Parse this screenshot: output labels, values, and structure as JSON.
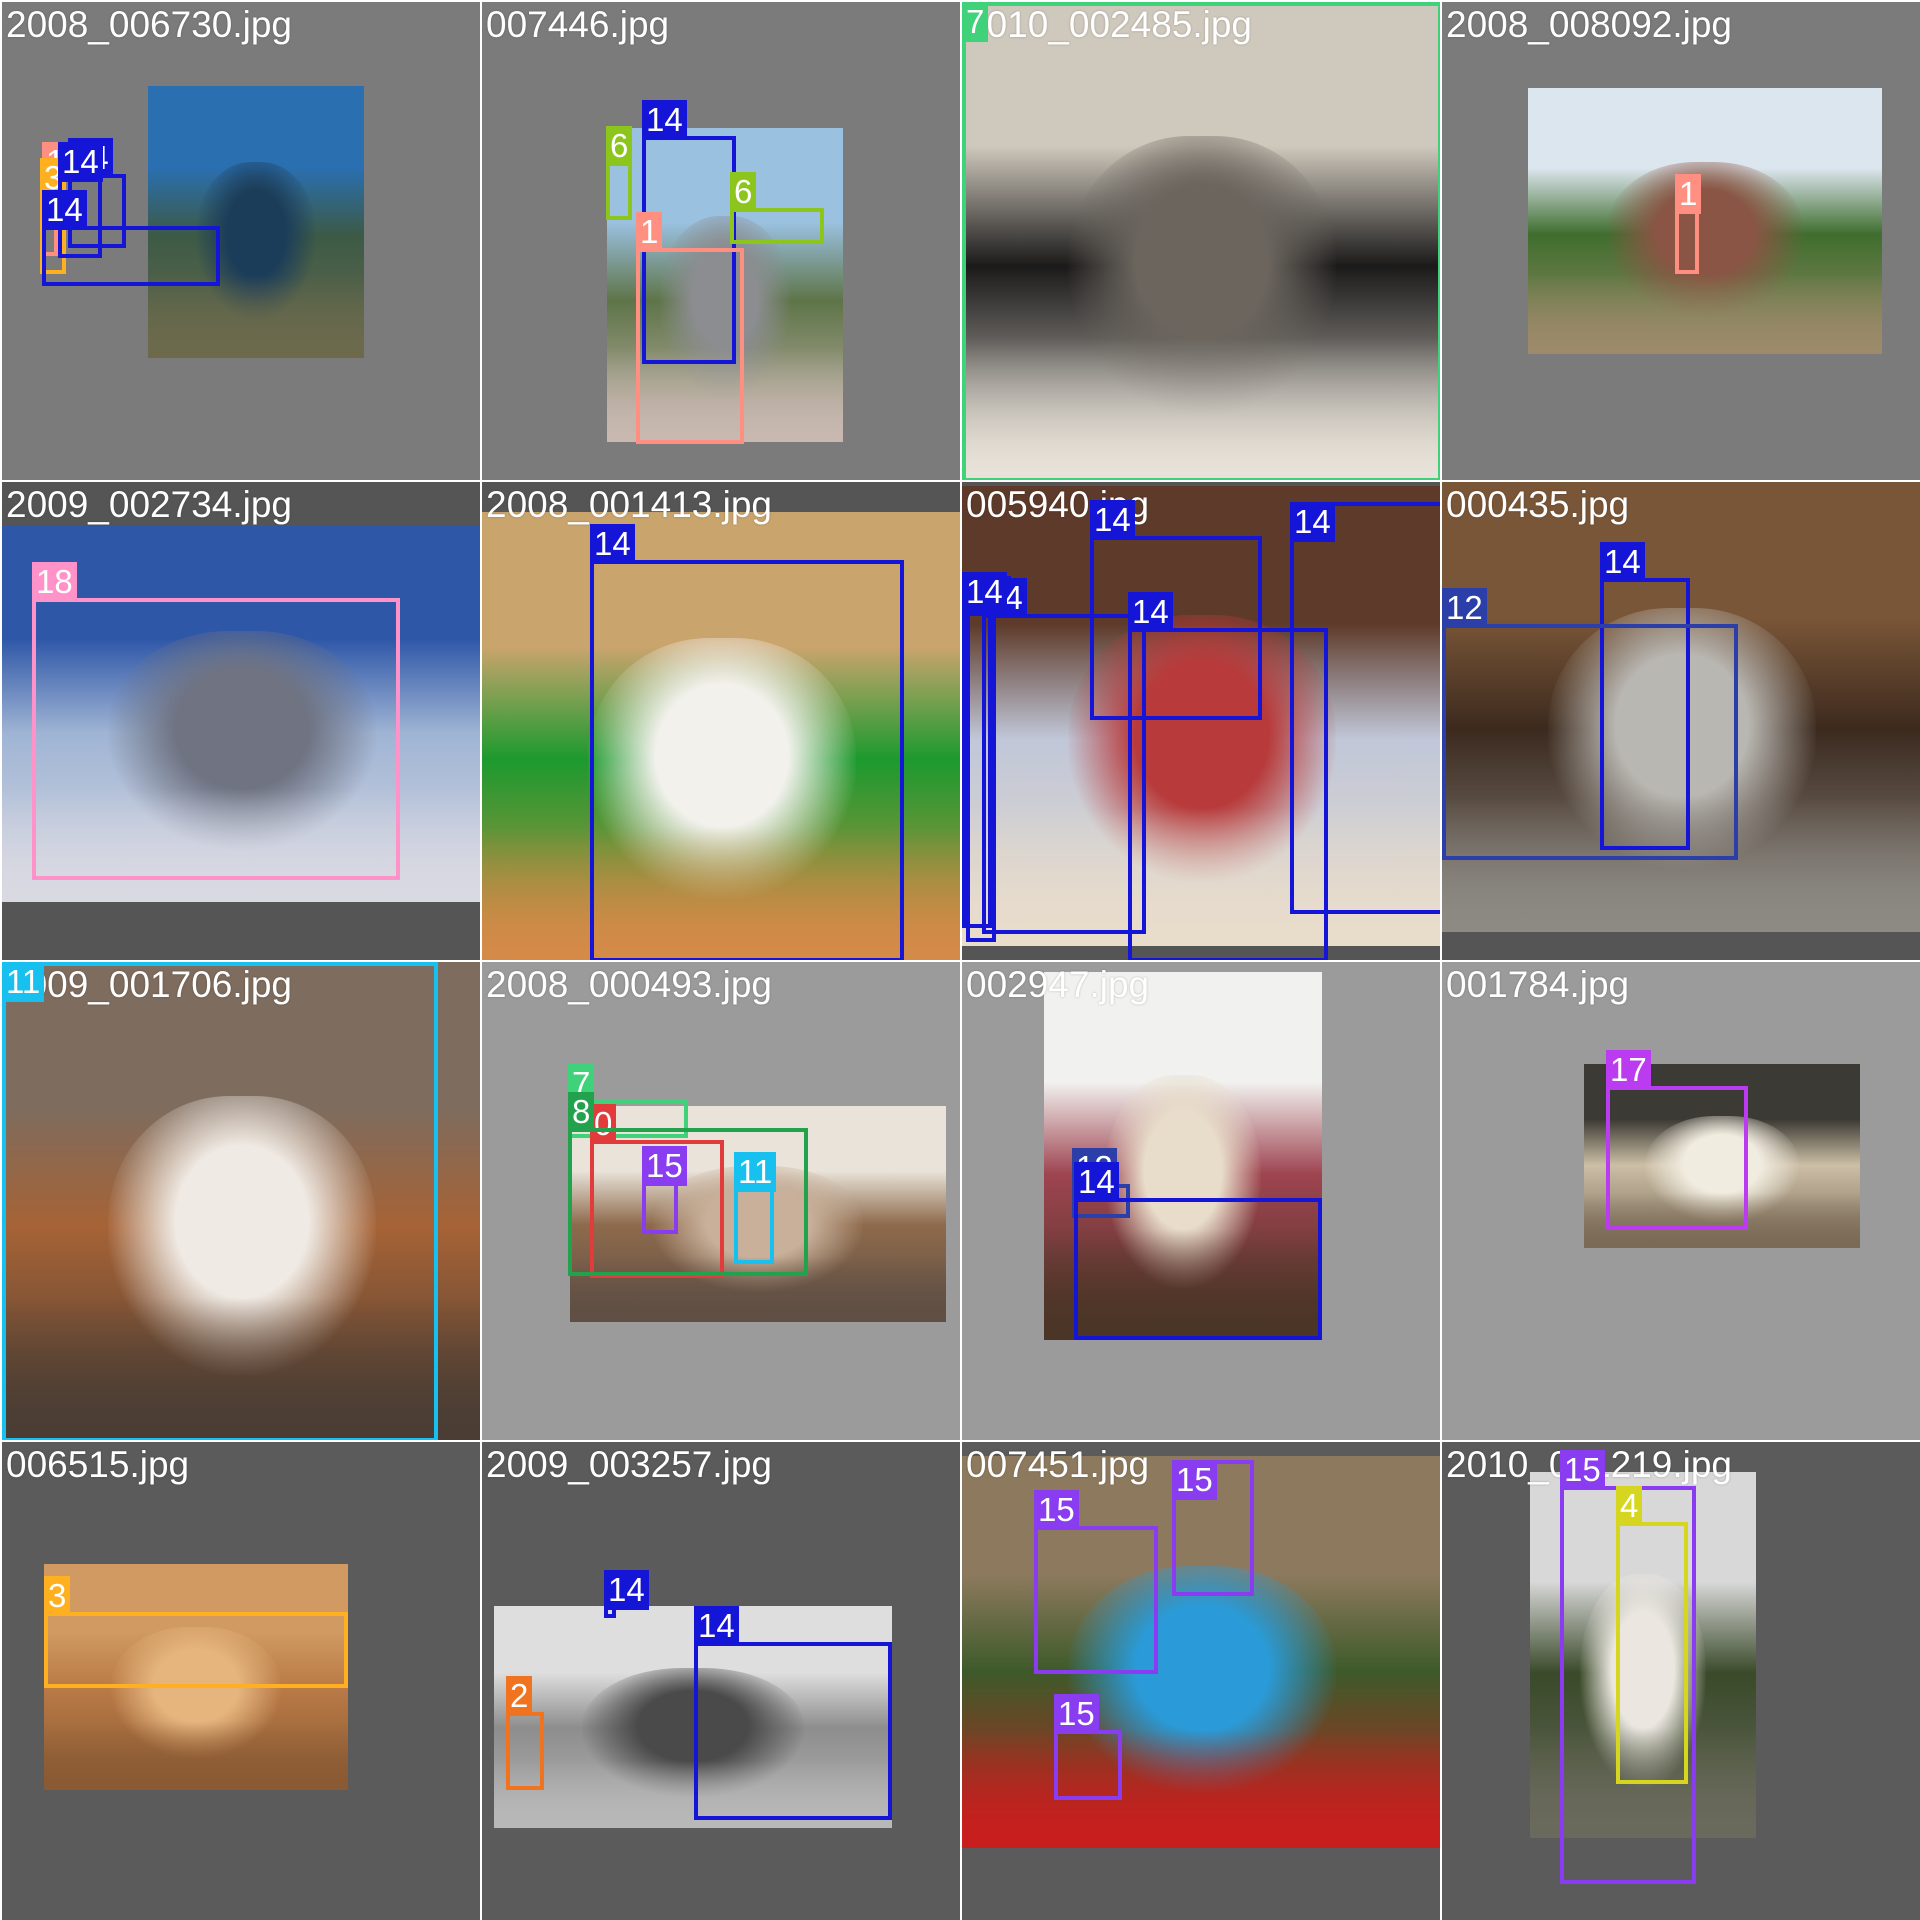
{
  "colors": {
    "canvas": "#ffffff",
    "label_text": "#ffffff",
    "filename_text": "#ffffff",
    "class": {
      "0": "#e23b3b",
      "1": "#ff8f80",
      "3": "#ffb020",
      "4": "#d6d620",
      "6": "#8cc51c",
      "7": "#3fd27a",
      "8": "#23a24e",
      "11": "#18c0ef",
      "12": "#2c3ea8",
      "14": "#1515d8",
      "15": "#8a3cf0",
      "17": "#bb3cf0",
      "18": "#ff92c8",
      "2": "#f07420"
    }
  },
  "tiles": [
    {
      "file": "2008_006730.jpg",
      "bg": "#7b7b7b",
      "scene": [
        "#2a6fb0",
        "#3c5a46",
        "#1c3d5a",
        "#6d6a4c"
      ],
      "labels": [
        "1",
        "14",
        "3",
        "14",
        "14"
      ]
    },
    {
      "file": "007446.jpg",
      "bg": "#7b7b7b",
      "scene": [
        "#9ac1e0",
        "#5e7448",
        "#8b8d90",
        "#c8b8b0"
      ],
      "labels": [
        "14",
        "6",
        "6",
        "1"
      ]
    },
    {
      "file": "2010_002485.jpg",
      "bg": "#7b7b7b",
      "scene": [
        "#cfc8bc",
        "#1b1a1a",
        "#6b655e",
        "#e8e2d8"
      ],
      "labels": [
        "7"
      ]
    },
    {
      "file": "2008_008092.jpg",
      "bg": "#7b7b7b",
      "scene": [
        "#dce6ef",
        "#3f6e2e",
        "#8a5544",
        "#9c8a6a"
      ],
      "labels": [
        "1"
      ]
    },
    {
      "file": "2009_002734.jpg",
      "bg": "#555555",
      "scene": [
        "#2f57a8",
        "#9fb4d4",
        "#6f7382",
        "#d9d9e2"
      ],
      "labels": [
        "18"
      ]
    },
    {
      "file": "2008_001413.jpg",
      "bg": "#555555",
      "scene": [
        "#c9a46d",
        "#1c9a2e",
        "#f2f1ec",
        "#d58a48"
      ],
      "labels": [
        "14"
      ]
    },
    {
      "file": "005940.jpg",
      "bg": "#555555",
      "scene": [
        "#5e3a2a",
        "#c0c7d8",
        "#b83a3a",
        "#e8dccb"
      ],
      "labels": [
        "14",
        "14",
        "14",
        "14",
        "14",
        "14"
      ]
    },
    {
      "file": "000435.jpg",
      "bg": "#555555",
      "scene": [
        "#7a5638",
        "#3c2a1e",
        "#b9b7b2",
        "#8d8a84"
      ],
      "labels": [
        "14",
        "12"
      ]
    },
    {
      "file": "2009_001706.jpg",
      "bg": "#555555",
      "scene": [
        "#7e6c5e",
        "#a66336",
        "#efeae4",
        "#4a3d34"
      ],
      "labels": [
        "11"
      ]
    },
    {
      "file": "2008_000493.jpg",
      "bg": "#9b9b9b",
      "scene": [
        "#e9e3d9",
        "#8e6a4c",
        "#c8b09a",
        "#5f4f44"
      ],
      "labels": [
        "7",
        "0",
        "8",
        "15",
        "11"
      ]
    },
    {
      "file": "002947.jpg",
      "bg": "#9b9b9b",
      "scene": [
        "#f1f1ef",
        "#9e4450",
        "#e8ddca",
        "#4a3526"
      ],
      "labels": [
        "12",
        "14"
      ]
    },
    {
      "file": "001784.jpg",
      "bg": "#9b9b9b",
      "scene": [
        "#3c3a34",
        "#ccbfa6",
        "#f1ece0",
        "#7a6a56"
      ],
      "labels": [
        "17"
      ]
    },
    {
      "file": "006515.jpg",
      "bg": "#5b5b5b",
      "scene": [
        "#d09a62",
        "#b97a46",
        "#e6b57e",
        "#8a5a34"
      ],
      "labels": [
        "3"
      ]
    },
    {
      "file": "2009_003257.jpg",
      "bg": "#5b5b5b",
      "scene": [
        "#dedede",
        "#8d8d8d",
        "#4a4a4a",
        "#b8b8b8"
      ],
      "labels": [
        "14",
        "14",
        "2"
      ]
    },
    {
      "file": "007451.jpg",
      "bg": "#5b5b5b",
      "scene": [
        "#8d7a5e",
        "#3e5a2a",
        "#2a9bd8",
        "#c81e1e"
      ],
      "labels": [
        "15",
        "15",
        "15"
      ]
    },
    {
      "file": "2010_001219.jpg",
      "bg": "#5b5b5b",
      "scene": [
        "#d8d8d8",
        "#3a4a2a",
        "#ebe7e0",
        "#6a6a5c"
      ],
      "labels": [
        "15",
        "4"
      ]
    }
  ]
}
